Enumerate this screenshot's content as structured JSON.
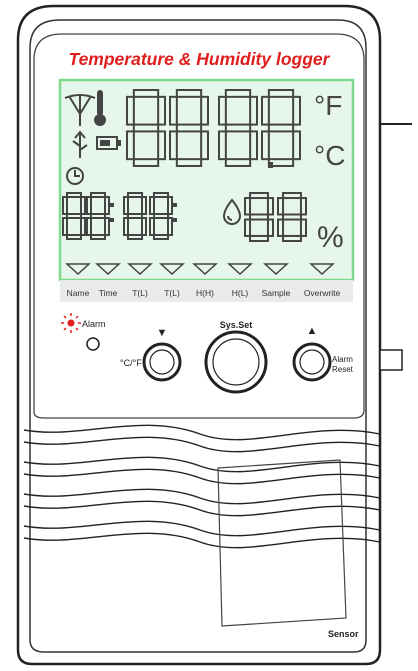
{
  "device": {
    "title": "Temperature & Humidity logger",
    "colors": {
      "title": "#e11d1d",
      "lcd_background": "#e7f6ea",
      "lcd_border": "#7fd98d",
      "body_outline": "#222222",
      "alarm": "#e11d1d"
    }
  },
  "display": {
    "temp_digits": [
      "8",
      "8",
      "8",
      "8"
    ],
    "time_digits": [
      "8",
      "8",
      "8",
      "8"
    ],
    "humidity_digits": [
      "8",
      "8"
    ],
    "unit_f": "°F",
    "unit_c": "°C",
    "percent": "%",
    "icons": [
      "antenna-icon",
      "thermometer-icon",
      "usb-icon",
      "battery-icon",
      "clock-icon",
      "droplet-icon"
    ]
  },
  "labels": {
    "items": [
      "Name",
      "Time",
      "T(L)",
      "T(L)",
      "H(H)",
      "H(L)",
      "Sample",
      "Overwrite"
    ]
  },
  "controls": {
    "alarm_label": "Alarm",
    "unit_button_label": "°C/°F",
    "set_button_label": "Sys.Set",
    "alarm_reset_line1": "Alarm",
    "alarm_reset_line2": "Reset",
    "down_arrow": "▼",
    "up_arrow": "▲"
  },
  "footer": {
    "sensor_label": "Sensor"
  }
}
